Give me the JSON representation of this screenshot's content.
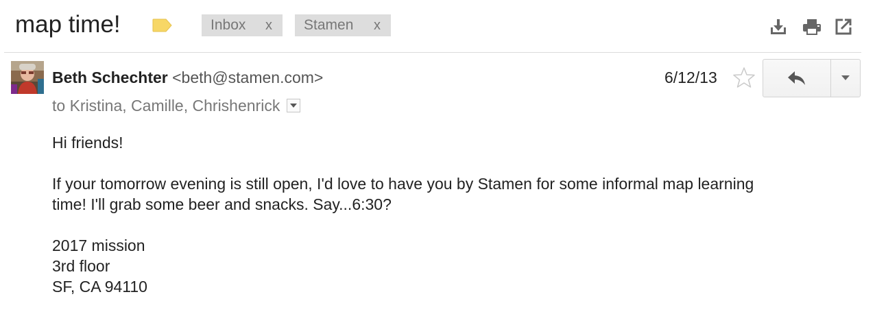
{
  "thread": {
    "subject": "map time!",
    "labels": [
      {
        "name": "Inbox",
        "remove": "x"
      },
      {
        "name": "Stamen",
        "remove": "x"
      }
    ],
    "label_marker_color": "#f7d766",
    "toolbar_icons": [
      "download-icon",
      "print-icon",
      "new-window-icon"
    ]
  },
  "message": {
    "sender_name": "Beth Schechter",
    "sender_email": "<beth@stamen.com>",
    "date": "6/12/13",
    "recipients": "to Kristina, Camille, Chrishenrick",
    "body": {
      "greeting": "Hi friends!",
      "paragraph_line1": "If your tomorrow evening is still open, I'd love to have you by Stamen for some informal map learning",
      "paragraph_line2": "time! I'll grab some beer and snacks. Say...6:30?",
      "address": [
        "2017 mission",
        "3rd floor",
        "SF, CA 94110"
      ]
    }
  }
}
